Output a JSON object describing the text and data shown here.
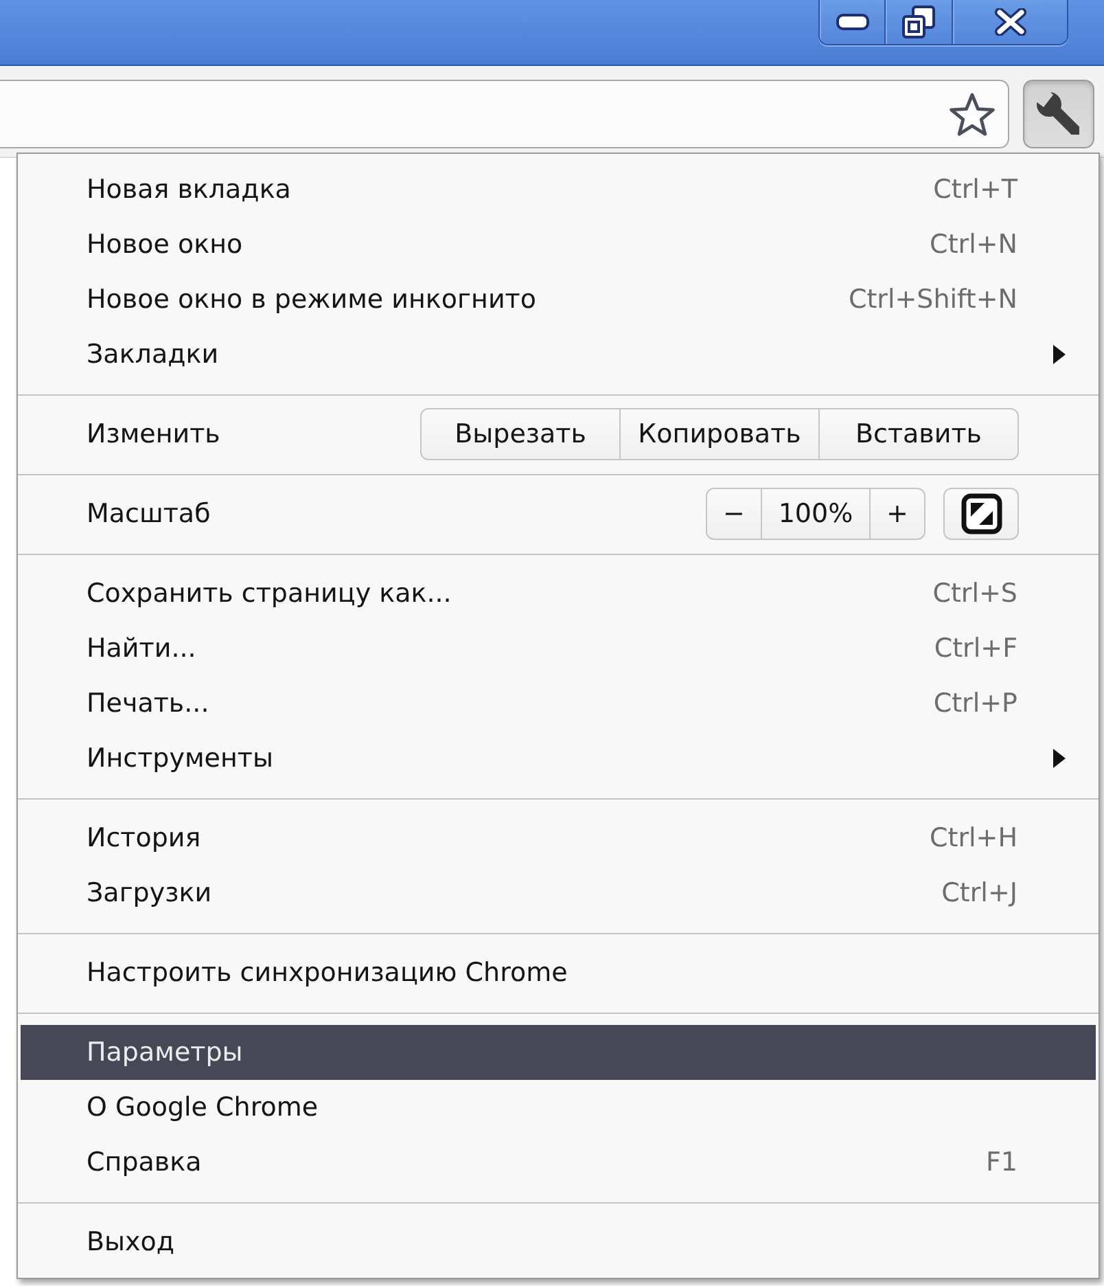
{
  "menu": {
    "sections": [
      {
        "items": [
          {
            "kind": "command",
            "label": "Новая вкладка",
            "shortcut": "Ctrl+T",
            "selected": false
          },
          {
            "kind": "command",
            "label": "Новое окно",
            "shortcut": "Ctrl+N",
            "selected": false
          },
          {
            "kind": "command",
            "label": "Новое окно в режиме инкогнито",
            "shortcut": "Ctrl+Shift+N",
            "selected": false
          },
          {
            "kind": "submenu",
            "label": "Закладки",
            "selected": false
          }
        ]
      },
      {
        "items": [
          {
            "kind": "edit",
            "label": "Изменить",
            "selected": false,
            "buttons": [
              "Вырезать",
              "Копировать",
              "Вставить"
            ]
          }
        ]
      },
      {
        "items": [
          {
            "kind": "zoom",
            "label": "Масштаб",
            "selected": false,
            "decrease": "−",
            "zoom_value": "100%",
            "increase": "+"
          }
        ]
      },
      {
        "items": [
          {
            "kind": "command",
            "label": "Сохранить страницу как...",
            "shortcut": "Ctrl+S",
            "selected": false
          },
          {
            "kind": "command",
            "label": "Найти...",
            "shortcut": "Ctrl+F",
            "selected": false
          },
          {
            "kind": "command",
            "label": "Печать...",
            "shortcut": "Ctrl+P",
            "selected": false
          },
          {
            "kind": "submenu",
            "label": "Инструменты",
            "selected": false
          }
        ]
      },
      {
        "items": [
          {
            "kind": "command",
            "label": "История",
            "shortcut": "Ctrl+H",
            "selected": false
          },
          {
            "kind": "command",
            "label": "Загрузки",
            "shortcut": "Ctrl+J",
            "selected": false
          }
        ]
      },
      {
        "items": [
          {
            "kind": "command",
            "label": "Настроить синхронизацию Chrome",
            "selected": false
          }
        ]
      },
      {
        "items": [
          {
            "kind": "command",
            "label": "Параметры",
            "selected": true
          },
          {
            "kind": "command",
            "label": "О Google Chrome",
            "selected": false
          },
          {
            "kind": "command",
            "label": "Справка",
            "shortcut": "F1",
            "selected": false
          }
        ]
      },
      {
        "items": [
          {
            "kind": "command",
            "label": "Выход",
            "selected": false
          }
        ]
      }
    ]
  }
}
